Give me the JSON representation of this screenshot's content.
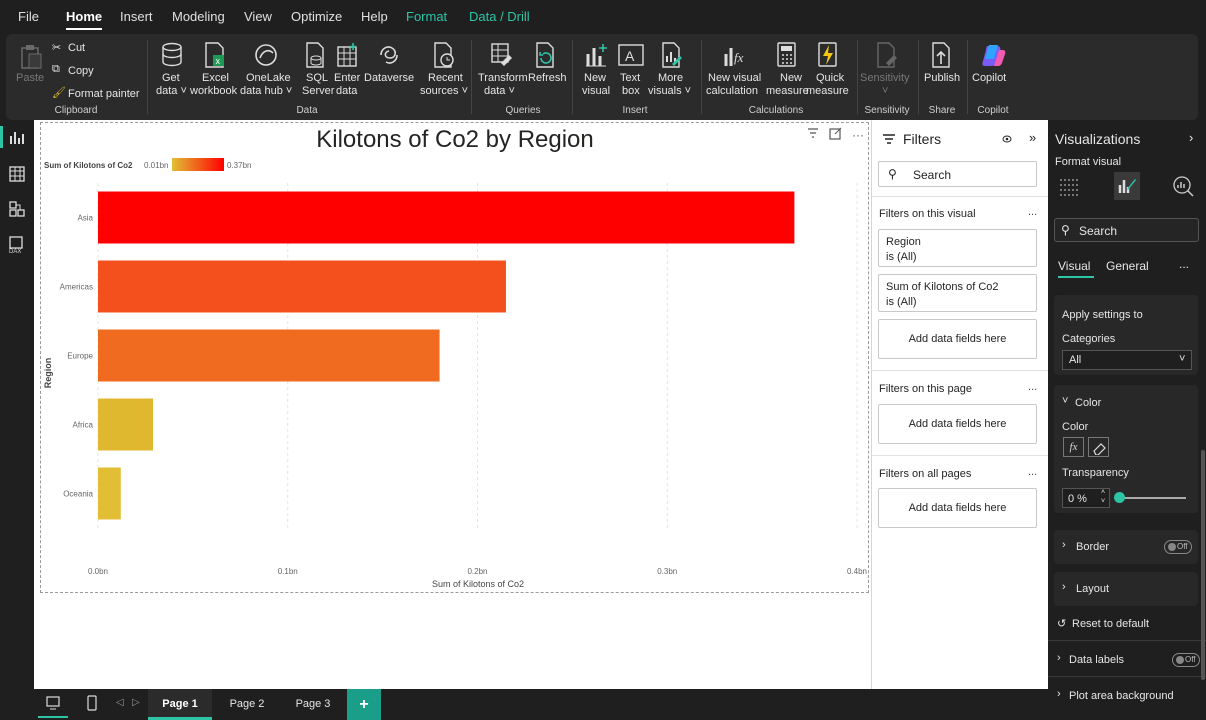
{
  "menu": {
    "items": [
      "File",
      "Home",
      "Insert",
      "Modeling",
      "View",
      "Optimize",
      "Help",
      "Format",
      "Data / Drill"
    ]
  },
  "ribbon": {
    "clipboard": {
      "paste": "Paste",
      "cut": "Cut",
      "copy": "Copy",
      "format_painter": "Format painter",
      "group": "Clipboard"
    },
    "data": {
      "get_data_1": "Get",
      "get_data_2": "data ˅",
      "excel_1": "Excel",
      "excel_2": "workbook",
      "onelake_1": "OneLake",
      "onelake_2": "data hub ˅",
      "sql_1": "SQL",
      "sql_2": "Server",
      "enter_1": "Enter",
      "enter_2": "data",
      "dataverse": "Dataverse",
      "recent_1": "Recent",
      "recent_2": "sources ˅",
      "group": "Data"
    },
    "queries": {
      "transform_1": "Transform",
      "transform_2": "data ˅",
      "refresh": "Refresh",
      "group": "Queries"
    },
    "insert": {
      "new_visual_1": "New",
      "new_visual_2": "visual",
      "text_box_1": "Text",
      "text_box_2": "box",
      "more_visuals_1": "More",
      "more_visuals_2": "visuals ˅",
      "group": "Insert"
    },
    "calculations": {
      "new_visual_calc_1": "New visual",
      "new_visual_calc_2": "calculation",
      "new_measure_1": "New",
      "new_measure_2": "measure",
      "quick_measure_1": "Quick",
      "quick_measure_2": "measure",
      "group": "Calculations"
    },
    "sensitivity": {
      "label": "Sensitivity",
      "caret": "˅",
      "group": "Sensitivity"
    },
    "share": {
      "publish": "Publish",
      "group": "Share"
    },
    "copilot": {
      "label": "Copilot",
      "group": "Copilot"
    }
  },
  "colors": {
    "accent_teal": "#2ec4a6",
    "bar_asia": "#ff0000",
    "bar_americas": "#f4501e",
    "bar_europe": "#f06b1f",
    "bar_africa": "#e0b830",
    "bar_oceania": "#e2be35"
  },
  "chart_data": {
    "type": "bar",
    "orientation": "horizontal",
    "title": "Kilotons of Co2 by Region",
    "legend": {
      "label": "Sum of Kilotons of Co2",
      "min": "0.01bn",
      "max": "0.37bn",
      "placement": "top-left",
      "colors": [
        "#e2be35",
        "#ff0000"
      ]
    },
    "categories": [
      "Asia",
      "Americas",
      "Europe",
      "Africa",
      "Oceania"
    ],
    "values": [
      0.367,
      0.215,
      0.18,
      0.029,
      0.012
    ],
    "bar_colors": [
      "#ff0000",
      "#f4501e",
      "#f06b1f",
      "#e0b830",
      "#e2be35"
    ],
    "xlabel": "Sum of Kilotons of Co2",
    "ylabel": "Region",
    "xlim": [
      0,
      0.4
    ],
    "xticks": [
      0,
      0.1,
      0.2,
      0.3,
      0.4
    ],
    "xtick_labels": [
      "0.0bn",
      "0.1bn",
      "0.2bn",
      "0.3bn",
      "0.4bn"
    ],
    "unit": "bn",
    "grid": true
  },
  "filters": {
    "title": "Filters",
    "search_placeholder": "Search",
    "on_visual": "Filters on this visual",
    "region_name": "Region",
    "region_state": "is (All)",
    "sum_name": "Sum of Kilotons of Co2",
    "sum_state": "is (All)",
    "add_fields": "Add data fields here",
    "on_page": "Filters on this page",
    "on_all": "Filters on all pages",
    "dots": "..."
  },
  "viz": {
    "title": "Visualizations",
    "format_visual": "Format visual",
    "search": "Search",
    "tab_visual": "Visual",
    "tab_general": "General",
    "dots": "...",
    "apply_settings": "Apply settings to",
    "categories_label": "Categories",
    "categories_value": "All",
    "color_section": "Color",
    "color_label": "Color",
    "fx": "fx",
    "transparency_label": "Transparency",
    "transparency_value": "0 %",
    "border": "Border",
    "off": "Off",
    "layout": "Layout",
    "reset": "Reset to default",
    "data_labels": "Data labels",
    "plot_area_bg": "Plot area background"
  },
  "pages": {
    "tabs": [
      "Page 1",
      "Page 2",
      "Page 3"
    ],
    "add": "+"
  }
}
